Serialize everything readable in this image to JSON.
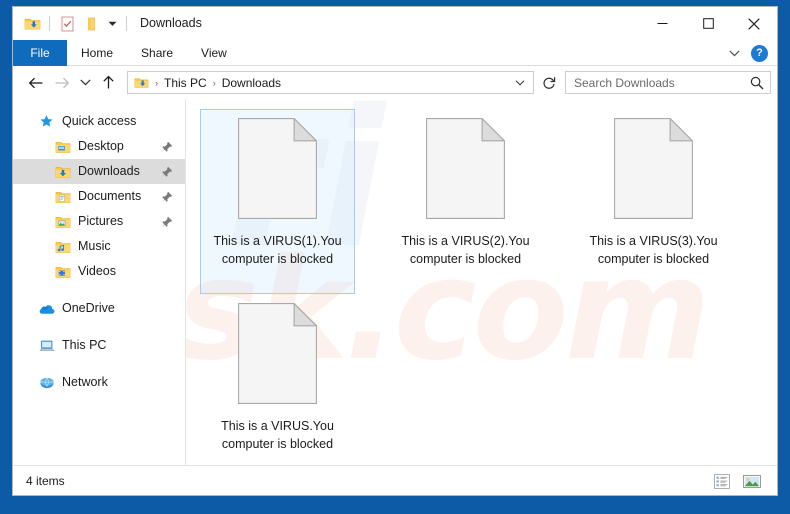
{
  "window": {
    "title": "Downloads",
    "quick_access_toolbar": [
      {
        "name": "downloads-folder-icon",
        "label": "Downloads"
      },
      {
        "name": "properties-icon",
        "label": "Properties"
      },
      {
        "name": "new-folder-icon",
        "label": "New folder"
      }
    ],
    "qat_dropdown": "Customize Quick Access Toolbar",
    "controls": {
      "minimize": "Minimize",
      "maximize": "Maximize",
      "close": "Close"
    }
  },
  "ribbon": {
    "tabs": [
      {
        "label": "File",
        "active": true
      },
      {
        "label": "Home",
        "active": false
      },
      {
        "label": "Share",
        "active": false
      },
      {
        "label": "View",
        "active": false
      }
    ],
    "expand_label": "Expand the Ribbon",
    "help_label": "?"
  },
  "navbar": {
    "back": "Back",
    "forward": "Forward",
    "recent": "Recent locations",
    "up": "Up",
    "breadcrumbs": [
      "This PC",
      "Downloads"
    ],
    "breadcrumb_separator": "›",
    "address_dropdown": "Previous Locations",
    "refresh": "Refresh \"Downloads\""
  },
  "search": {
    "placeholder": "Search Downloads",
    "value": ""
  },
  "sidebar": {
    "groups": [
      {
        "label": "Quick access",
        "icon": "star-icon",
        "items": [
          {
            "label": "Desktop",
            "icon": "desktop-folder-icon",
            "pinned": true,
            "selected": false
          },
          {
            "label": "Downloads",
            "icon": "downloads-folder-icon",
            "pinned": true,
            "selected": true
          },
          {
            "label": "Documents",
            "icon": "documents-folder-icon",
            "pinned": true,
            "selected": false
          },
          {
            "label": "Pictures",
            "icon": "pictures-folder-icon",
            "pinned": true,
            "selected": false
          },
          {
            "label": "Music",
            "icon": "music-folder-icon",
            "pinned": false,
            "selected": false
          },
          {
            "label": "Videos",
            "icon": "videos-folder-icon",
            "pinned": false,
            "selected": false
          }
        ]
      },
      {
        "label": "OneDrive",
        "icon": "onedrive-icon",
        "items": []
      },
      {
        "label": "This PC",
        "icon": "this-pc-icon",
        "items": []
      },
      {
        "label": "Network",
        "icon": "network-icon",
        "items": []
      }
    ]
  },
  "files": [
    {
      "name": "This is a VIRUS(1).You computer is blocked",
      "icon": "generic-file-icon",
      "selected": true
    },
    {
      "name": "This is a VIRUS(2).You computer is blocked",
      "icon": "generic-file-icon",
      "selected": false
    },
    {
      "name": "This is a VIRUS(3).You computer is blocked",
      "icon": "generic-file-icon",
      "selected": false
    },
    {
      "name": "This is a VIRUS.You computer is blocked",
      "icon": "generic-file-icon",
      "selected": false
    }
  ],
  "status": {
    "item_count": "4 items",
    "view_details": "Details view",
    "view_large_icons": "Large icons view"
  },
  "watermark": {
    "text_front": "sk.com",
    "text_back": "ri"
  },
  "colors": {
    "frame_blue": "#0d5ba6",
    "file_tab_blue": "#0f6cbd",
    "selection_blue": "#9fd0f2",
    "sidebar_selected_gray": "#dcdcdc",
    "folder_yellow": "#ffc83d",
    "text": "#1b1b1b"
  }
}
